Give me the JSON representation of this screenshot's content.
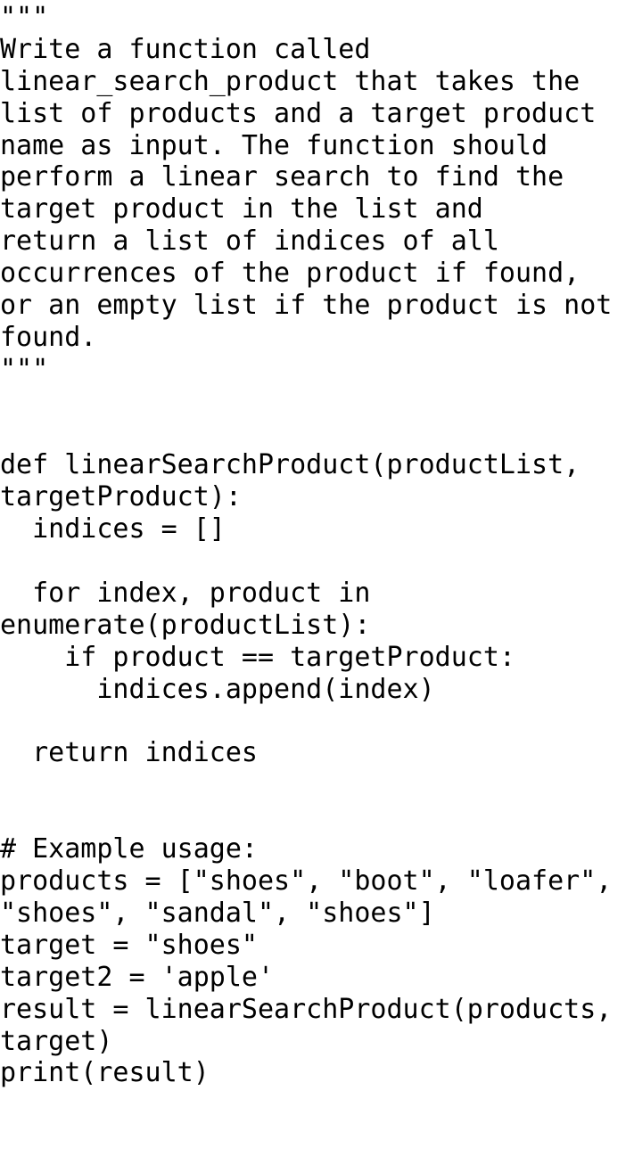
{
  "code": {
    "lines": [
      "\"\"\"",
      "Write a function called",
      "linear_search_product that takes the",
      "list of products and a target product",
      "name as input. The function should",
      "perform a linear search to find the",
      "target product in the list and",
      "return a list of indices of all",
      "occurrences of the product if found,",
      "or an empty list if the product is not",
      "found.",
      "\"\"\"",
      "",
      "",
      "def linearSearchProduct(productList,",
      "targetProduct):",
      "  indices = []",
      "",
      "  for index, product in",
      "enumerate(productList):",
      "    if product == targetProduct:",
      "      indices.append(index)",
      "",
      "  return indices",
      "",
      "",
      "# Example usage:",
      "products = [\"shoes\", \"boot\", \"loafer\",",
      "\"shoes\", \"sandal\", \"shoes\"]",
      "target = \"shoes\"",
      "target2 = 'apple'",
      "result = linearSearchProduct(products,",
      "target)",
      "print(result)"
    ]
  }
}
